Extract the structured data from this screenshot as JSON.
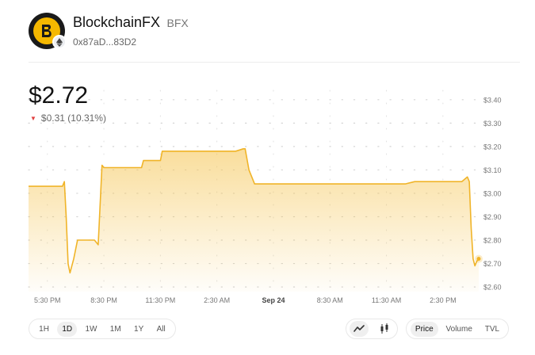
{
  "token": {
    "name": "BlockchainFX",
    "symbol": "BFX",
    "address": "0x87aD...83D2",
    "logo_icon": "bfx-logo-icon",
    "chain_icon": "ethereum-icon",
    "brand_color": "#F5B800"
  },
  "price": {
    "current": "$2.72",
    "change": "$0.31 (10.31%)",
    "direction": "down",
    "down_color": "#e04040"
  },
  "chart_data": {
    "type": "line",
    "title": "",
    "xlabel": "",
    "ylabel": "",
    "ylim": [
      2.58,
      3.44
    ],
    "y_ticks": [
      "$3.40",
      "$3.30",
      "$3.20",
      "$3.10",
      "$3.00",
      "$2.90",
      "$2.80",
      "$2.70",
      "$2.60"
    ],
    "y_tick_values": [
      3.4,
      3.3,
      3.2,
      3.1,
      3.0,
      2.9,
      2.8,
      2.7,
      2.6
    ],
    "x_ticks": [
      "5:30 PM",
      "8:30 PM",
      "11:30 PM",
      "2:30 AM",
      "Sep 24",
      "8:30 AM",
      "11:30 AM",
      "2:30 PM"
    ],
    "x_tick_hours": [
      1,
      4,
      7,
      10,
      13,
      16,
      19,
      22
    ],
    "x_range_hours": [
      0,
      23.9
    ],
    "grid": "dotted",
    "line_color": "#F0B429",
    "series": [
      {
        "x": [
          0,
          1.8,
          1.9,
          2.0,
          2.1,
          2.2,
          2.4,
          2.6,
          2.8,
          3.5,
          3.7,
          3.8,
          3.9,
          4.0,
          4.2,
          4.5,
          6.0,
          6.1,
          6.3,
          7.0,
          7.1,
          7.3,
          10.0,
          11.0,
          11.4,
          11.5,
          11.7,
          12.0,
          20.0,
          20.5,
          23.0,
          23.3,
          23.4,
          23.5,
          23.6,
          23.7,
          23.8,
          23.9
        ],
        "y": [
          3.03,
          3.03,
          3.05,
          2.9,
          2.7,
          2.66,
          2.72,
          2.8,
          2.8,
          2.8,
          2.78,
          2.95,
          3.12,
          3.11,
          3.11,
          3.11,
          3.11,
          3.14,
          3.14,
          3.14,
          3.18,
          3.18,
          3.18,
          3.18,
          3.19,
          3.19,
          3.1,
          3.04,
          3.04,
          3.05,
          3.05,
          3.07,
          3.05,
          2.85,
          2.72,
          2.69,
          2.71,
          2.72
        ]
      }
    ]
  },
  "controls": {
    "timeframes": [
      {
        "label": "1H",
        "active": false
      },
      {
        "label": "1D",
        "active": true
      },
      {
        "label": "1W",
        "active": false
      },
      {
        "label": "1M",
        "active": false
      },
      {
        "label": "1Y",
        "active": false
      },
      {
        "label": "All",
        "active": false
      }
    ],
    "chart_types": [
      {
        "icon": "line-chart-icon",
        "active": true
      },
      {
        "icon": "candlestick-icon",
        "active": false
      }
    ],
    "metrics": [
      {
        "label": "Price",
        "active": true
      },
      {
        "label": "Volume",
        "active": false
      },
      {
        "label": "TVL",
        "active": false
      }
    ]
  }
}
